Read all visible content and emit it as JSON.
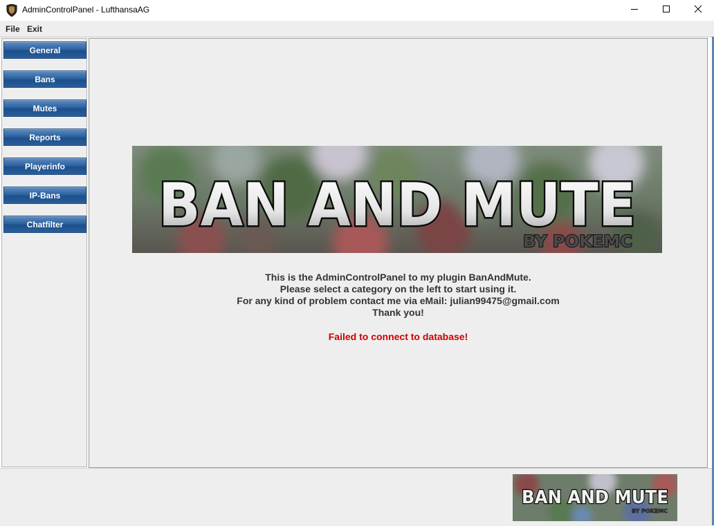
{
  "window": {
    "title": "AdminControlPanel - LufthansaAG",
    "icon": "app-shield-icon",
    "controls": [
      "minimize-icon",
      "maximize-icon",
      "close-icon"
    ]
  },
  "menu": {
    "file": "File",
    "exit": "Exit"
  },
  "sidebar": {
    "items": [
      {
        "label": "General"
      },
      {
        "label": "Bans"
      },
      {
        "label": "Mutes"
      },
      {
        "label": "Reports"
      },
      {
        "label": "Playerinfo"
      },
      {
        "label": "IP-Bans"
      },
      {
        "label": "Chatfilter"
      }
    ]
  },
  "banner": {
    "title": "BAN AND MUTE",
    "subtitle": "BY POKEMC"
  },
  "main": {
    "lines": [
      "This is the AdminControlPanel to my plugin BanAndMute.",
      "Please select a category on the left to start using it.",
      "For any kind of problem contact me via eMail: julian99475@gmail.com",
      "Thank you!"
    ],
    "error": "Failed to connect to database!"
  },
  "colors": {
    "button_top": "#5d8bbf",
    "button_bottom": "#1c4f8c",
    "error_text": "#cc0000",
    "panel_bg": "#eeeeee"
  }
}
